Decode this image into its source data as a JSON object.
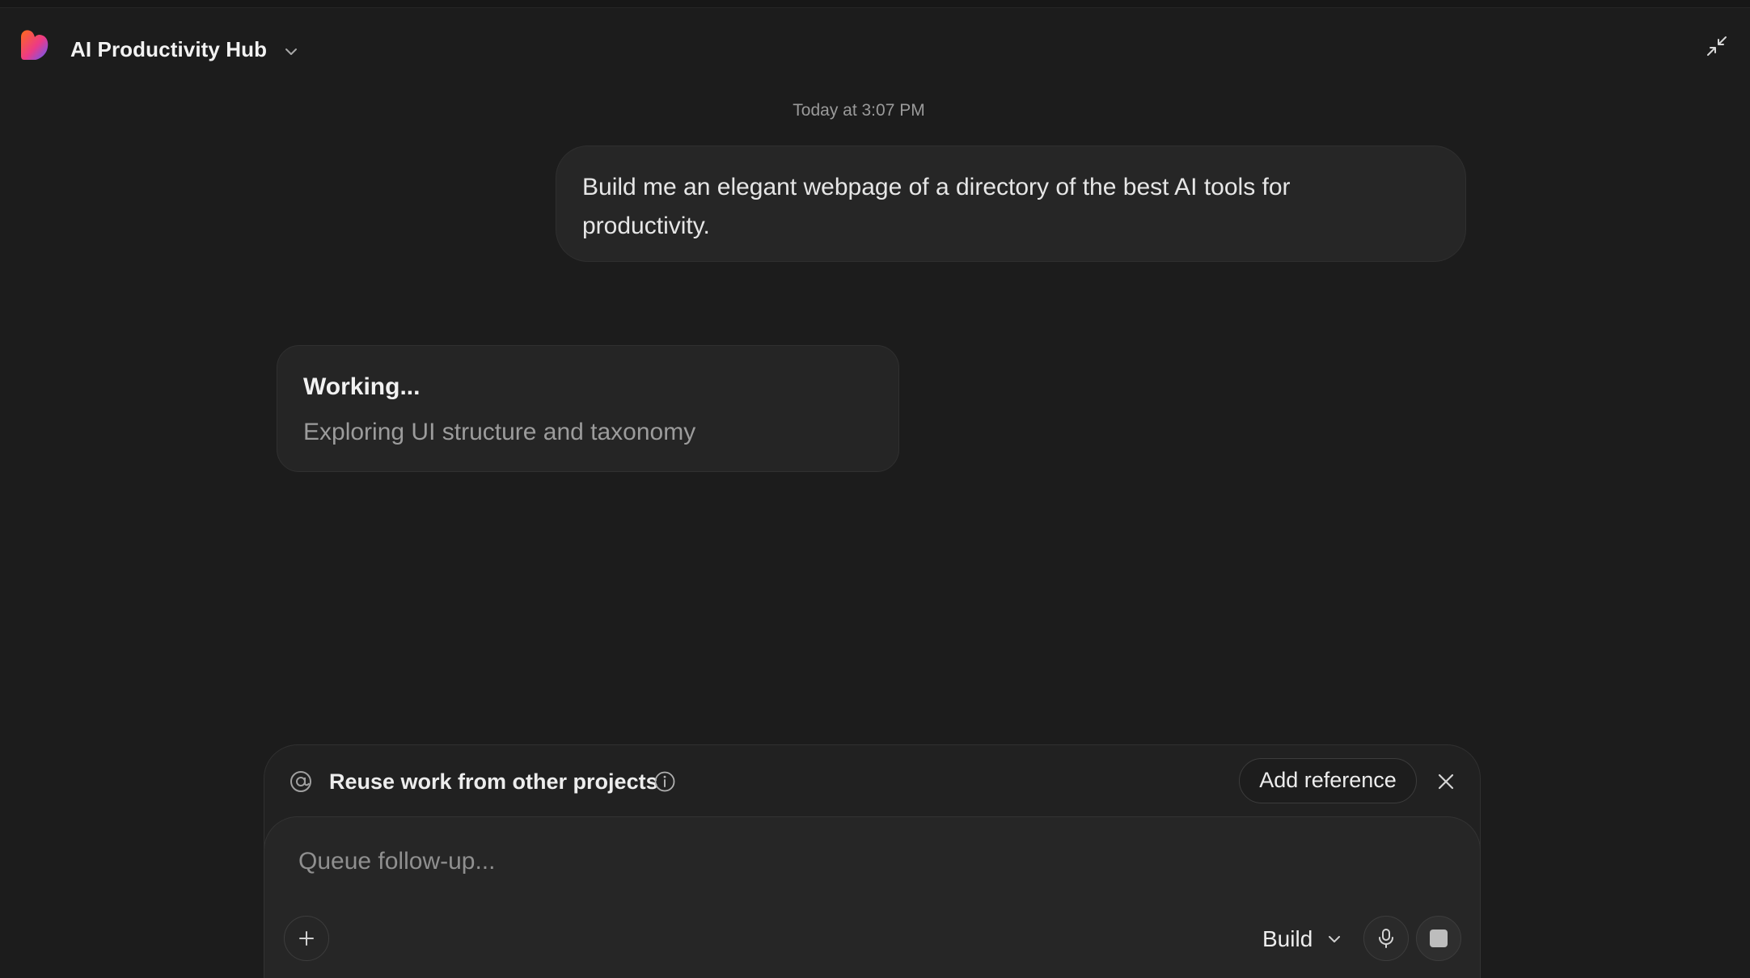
{
  "header": {
    "project_title": "AI Productivity Hub",
    "logo_icon": "lovable-heart-logo",
    "dropdown_icon": "chevron-down-icon",
    "collapse_icon": "collapse-arrows-icon"
  },
  "chat": {
    "timestamp": "Today at 3:07 PM",
    "user_message": "Build me an elegant webpage of a directory of the best AI tools for productivity.",
    "status": {
      "title": "Working...",
      "detail": "Exploring UI structure and taxonomy"
    }
  },
  "composer": {
    "reference_bar": {
      "label": "Reuse work from other projects",
      "at_icon": "at-sign-icon",
      "info_icon": "info-icon",
      "add_reference_label": "Add reference",
      "close_icon": "close-icon"
    },
    "input": {
      "value": "",
      "placeholder": "Queue follow-up..."
    },
    "plus_icon": "plus-icon",
    "mode": {
      "selected": "Build"
    },
    "mic_icon": "microphone-icon",
    "stop_icon": "stop-icon"
  },
  "colors": {
    "background": "#1c1c1c",
    "bubble": "#262626",
    "text_primary": "#ececec",
    "text_muted": "#9c9c9c",
    "logo_gradient": [
      "#ff5a1f",
      "#e6338a",
      "#6a5cff"
    ]
  }
}
